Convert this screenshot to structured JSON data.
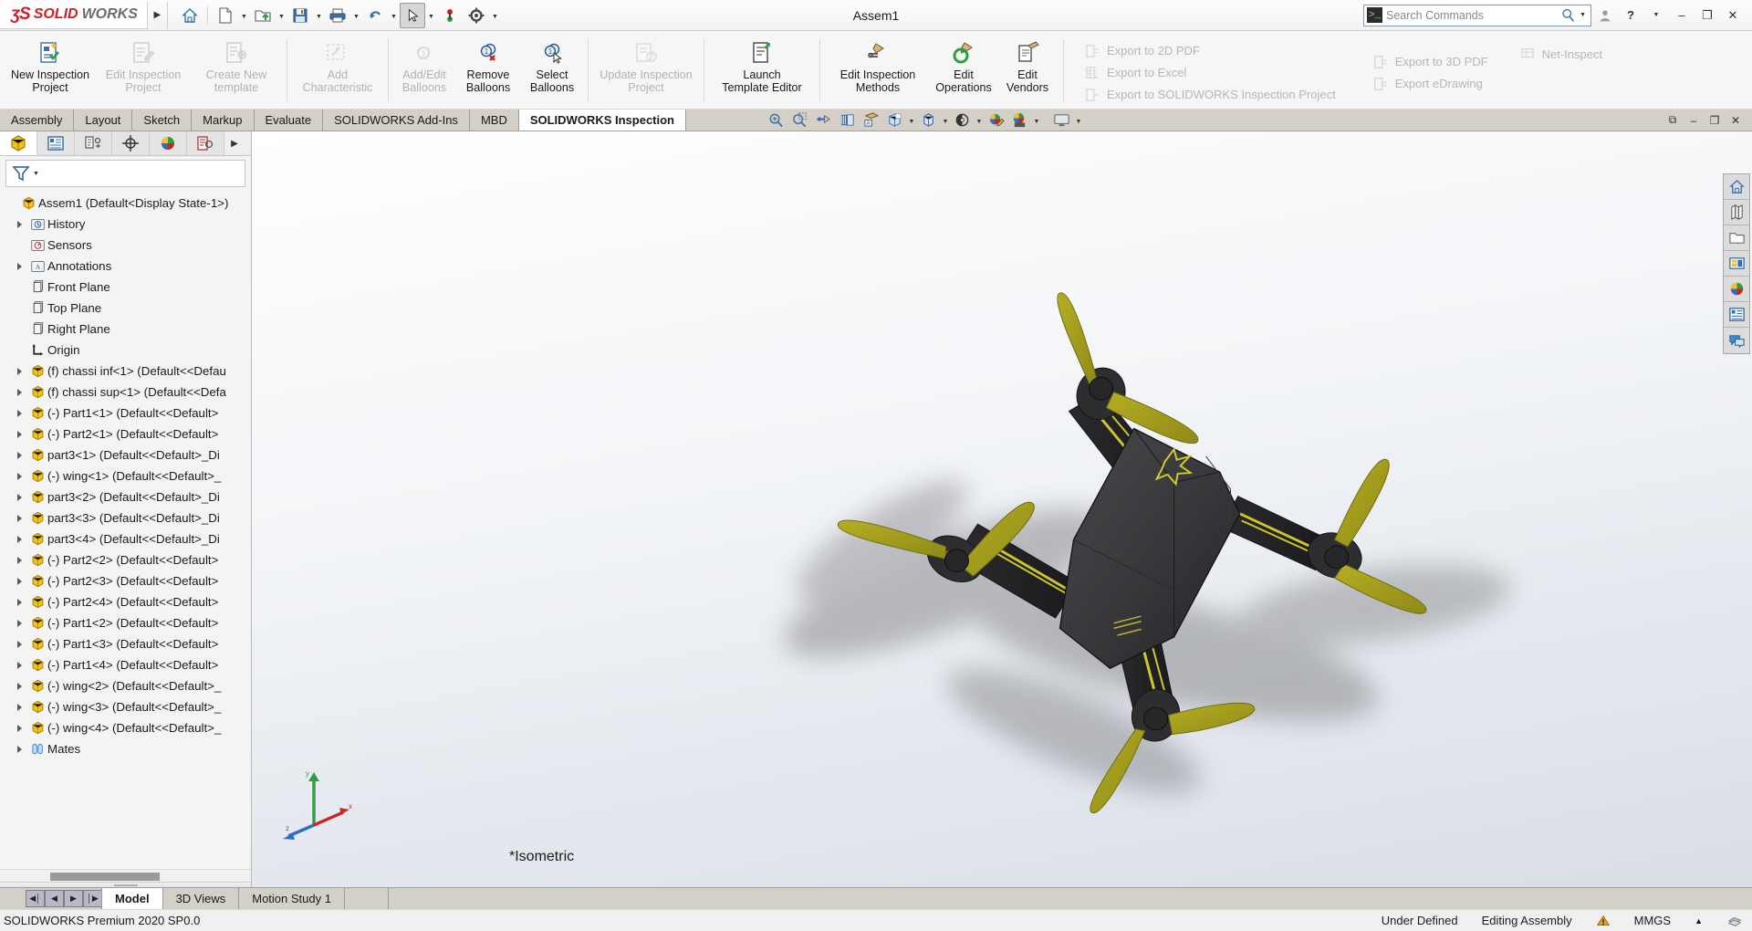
{
  "titlebar": {
    "brand_ds": "ʒS",
    "brand_solid": "SOLID",
    "brand_works": "WORKS",
    "document_title": "Assem1",
    "qat": [
      {
        "name": "home-icon",
        "label": "Home"
      },
      {
        "name": "new-document-icon",
        "label": "New"
      },
      {
        "name": "open-folder-icon",
        "label": "Open"
      },
      {
        "name": "save-icon",
        "label": "Save"
      },
      {
        "name": "print-icon",
        "label": "Print"
      },
      {
        "name": "undo-icon",
        "label": "Undo"
      },
      {
        "name": "select-cursor-icon",
        "label": "Select"
      },
      {
        "name": "rebuild-icon",
        "label": "Rebuild"
      },
      {
        "name": "options-gear-icon",
        "label": "Options"
      }
    ],
    "search_placeholder": "Search Commands",
    "account_label": "Account",
    "help_label": "Help",
    "minimize_label": "–",
    "restore_label": "❐",
    "close_label": "✕"
  },
  "ribbon": {
    "buttons": [
      {
        "label": "New Inspection\nProject",
        "l1": "New Inspection",
        "l2": "Project",
        "icon": "new-inspection-project-icon",
        "disabled": false
      },
      {
        "label": "Edit Inspection Project",
        "l1": "Edit Inspection",
        "l2": "Project",
        "icon": "edit-inspection-project-icon",
        "disabled": true
      },
      {
        "label": "Create New template",
        "l1": "Create New",
        "l2": "template",
        "icon": "create-new-template-icon",
        "disabled": true
      },
      {
        "label": "Add Characteristic",
        "l1": "Add",
        "l2": "Characteristic",
        "icon": "add-characteristic-icon",
        "disabled": true
      },
      {
        "label": "Add/Edit Balloons",
        "l1": "Add/Edit",
        "l2": "Balloons",
        "icon": "add-edit-balloons-icon",
        "disabled": true
      },
      {
        "label": "Remove Balloons",
        "l1": "Remove",
        "l2": "Balloons",
        "icon": "remove-balloons-icon",
        "disabled": false
      },
      {
        "label": "Select Balloons",
        "l1": "Select",
        "l2": "Balloons",
        "icon": "select-balloons-icon",
        "disabled": false
      },
      {
        "label": "Update Inspection Project",
        "l1": "Update Inspection",
        "l2": "Project",
        "icon": "update-inspection-project-icon",
        "disabled": true
      },
      {
        "label": "Launch Template Editor",
        "l1": "Launch",
        "l2": "Template Editor",
        "icon": "launch-template-editor-icon",
        "disabled": false
      },
      {
        "label": "Edit Inspection Methods",
        "l1": "Edit Inspection",
        "l2": "Methods",
        "icon": "edit-inspection-methods-icon",
        "disabled": false
      },
      {
        "label": "Edit Operations",
        "l1": "Edit",
        "l2": "Operations",
        "icon": "edit-operations-icon",
        "disabled": false
      },
      {
        "label": "Edit Vendors",
        "l1": "Edit",
        "l2": "Vendors",
        "icon": "edit-vendors-icon",
        "disabled": false
      }
    ],
    "export_col1": [
      {
        "label": "Export to 2D PDF",
        "icon": "export-2d-pdf-icon",
        "disabled": true
      },
      {
        "label": "Export to Excel",
        "icon": "export-excel-icon",
        "disabled": true
      },
      {
        "label": "Export to SOLIDWORKS Inspection Project",
        "icon": "export-sw-inspection-icon",
        "disabled": true
      }
    ],
    "export_col2": [
      {
        "label": "Export to 3D PDF",
        "icon": "export-3d-pdf-icon",
        "disabled": true
      },
      {
        "label": "Export eDrawing",
        "icon": "export-edrawing-icon",
        "disabled": true
      }
    ],
    "export_col3": [
      {
        "label": "Net-Inspect",
        "icon": "net-inspect-icon",
        "disabled": true
      }
    ]
  },
  "command_tabs": {
    "items": [
      {
        "label": "Assembly",
        "active": false
      },
      {
        "label": "Layout",
        "active": false
      },
      {
        "label": "Sketch",
        "active": false
      },
      {
        "label": "Markup",
        "active": false
      },
      {
        "label": "Evaluate",
        "active": false
      },
      {
        "label": "SOLIDWORKS Add-Ins",
        "active": false
      },
      {
        "label": "MBD",
        "active": false
      },
      {
        "label": "SOLIDWORKS Inspection",
        "active": true
      }
    ]
  },
  "view_toolbar": {
    "items": [
      {
        "name": "zoom-to-fit-icon",
        "label": "Zoom to Fit",
        "caret": false
      },
      {
        "name": "zoom-to-area-icon",
        "label": "Zoom to Area",
        "caret": false
      },
      {
        "name": "previous-view-icon",
        "label": "Previous View",
        "caret": false
      },
      {
        "name": "section-view-icon",
        "label": "Section View",
        "caret": false
      },
      {
        "name": "view-orientation-icon",
        "label": "View Orientation",
        "caret": false
      },
      {
        "name": "display-style-icon",
        "label": "Display Style",
        "caret": true
      },
      {
        "name": "hide-show-items-icon",
        "label": "Hide/Show Items",
        "caret": true
      },
      {
        "name": "edit-appearance-icon",
        "label": "Edit Appearance",
        "caret": false
      },
      {
        "name": "apply-scene-icon",
        "label": "Apply Scene",
        "caret": true
      },
      {
        "name": "view-settings-icon",
        "label": "View Settings",
        "caret": true
      }
    ],
    "window_buttons": [
      {
        "name": "restore-panel-icon",
        "label": "⧉"
      },
      {
        "name": "minimize-window-icon",
        "label": "–"
      },
      {
        "name": "restore-window-icon",
        "label": "❐"
      },
      {
        "name": "close-window-icon",
        "label": "✕"
      }
    ]
  },
  "feature_manager": {
    "tabs": [
      {
        "name": "featuremanager-design-tree-tab",
        "label": "FeatureManager design tree",
        "active": true
      },
      {
        "name": "property-manager-tab",
        "label": "PropertyManager",
        "active": false
      },
      {
        "name": "configuration-manager-tab",
        "label": "ConfigurationManager",
        "active": false
      },
      {
        "name": "dimxpert-manager-tab",
        "label": "DimXpertManager",
        "active": false
      },
      {
        "name": "display-manager-tab",
        "label": "DisplayManager",
        "active": false
      },
      {
        "name": "inspection-manager-tab",
        "label": "Inspection Manager",
        "active": false
      }
    ],
    "filter_placeholder": "",
    "root": "Assem1  (Default<Display State-1>)",
    "tree": [
      {
        "label": "History",
        "icon": "history-icon",
        "expandable": true,
        "indent": 1
      },
      {
        "label": "Sensors",
        "icon": "sensors-icon",
        "expandable": false,
        "indent": 1
      },
      {
        "label": "Annotations",
        "icon": "annotations-icon",
        "expandable": true,
        "indent": 1
      },
      {
        "label": "Front Plane",
        "icon": "plane-icon",
        "expandable": false,
        "indent": 1
      },
      {
        "label": "Top Plane",
        "icon": "plane-icon",
        "expandable": false,
        "indent": 1
      },
      {
        "label": "Right Plane",
        "icon": "plane-icon",
        "expandable": false,
        "indent": 1
      },
      {
        "label": "Origin",
        "icon": "origin-icon",
        "expandable": false,
        "indent": 1
      },
      {
        "label": "(f) chassi inf<1>  (Default<<Defau",
        "icon": "part-icon",
        "expandable": true,
        "indent": 1
      },
      {
        "label": "(f) chassi sup<1>  (Default<<Defa",
        "icon": "part-icon",
        "expandable": true,
        "indent": 1
      },
      {
        "label": "(-) Part1<1>  (Default<<Default>",
        "icon": "part-icon",
        "expandable": true,
        "indent": 1
      },
      {
        "label": "(-) Part2<1>  (Default<<Default>",
        "icon": "part-icon",
        "expandable": true,
        "indent": 1
      },
      {
        "label": "part3<1>  (Default<<Default>_Di",
        "icon": "part-icon",
        "expandable": true,
        "indent": 1
      },
      {
        "label": "(-) wing<1>  (Default<<Default>_",
        "icon": "part-icon",
        "expandable": true,
        "indent": 1
      },
      {
        "label": "part3<2>  (Default<<Default>_Di",
        "icon": "part-icon",
        "expandable": true,
        "indent": 1
      },
      {
        "label": "part3<3>  (Default<<Default>_Di",
        "icon": "part-icon",
        "expandable": true,
        "indent": 1
      },
      {
        "label": "part3<4>  (Default<<Default>_Di",
        "icon": "part-icon",
        "expandable": true,
        "indent": 1
      },
      {
        "label": "(-) Part2<2>  (Default<<Default>",
        "icon": "part-icon",
        "expandable": true,
        "indent": 1
      },
      {
        "label": "(-) Part2<3>  (Default<<Default>",
        "icon": "part-icon",
        "expandable": true,
        "indent": 1
      },
      {
        "label": "(-) Part2<4>  (Default<<Default>",
        "icon": "part-icon",
        "expandable": true,
        "indent": 1
      },
      {
        "label": "(-) Part1<2>  (Default<<Default>",
        "icon": "part-icon",
        "expandable": true,
        "indent": 1
      },
      {
        "label": "(-) Part1<3>  (Default<<Default>",
        "icon": "part-icon",
        "expandable": true,
        "indent": 1
      },
      {
        "label": "(-) Part1<4>  (Default<<Default>",
        "icon": "part-icon",
        "expandable": true,
        "indent": 1
      },
      {
        "label": "(-) wing<2>  (Default<<Default>_",
        "icon": "part-icon",
        "expandable": true,
        "indent": 1
      },
      {
        "label": "(-) wing<3>  (Default<<Default>_",
        "icon": "part-icon",
        "expandable": true,
        "indent": 1
      },
      {
        "label": "(-) wing<4>  (Default<<Default>_",
        "icon": "part-icon",
        "expandable": true,
        "indent": 1
      },
      {
        "label": "Mates",
        "icon": "mates-icon",
        "expandable": true,
        "indent": 1
      }
    ]
  },
  "viewport": {
    "view_name": "*Isometric",
    "axis_labels": {
      "x": "x",
      "y": "y",
      "z": "z"
    },
    "model_colors": {
      "body_dark": "#3a3a3c",
      "body_shadow": "#1e1e20",
      "propeller": "#a8a11e",
      "highlight": "#d8d430",
      "background_top": "#ffffff",
      "background_bottom": "#d8dde6"
    },
    "right_toolbar": [
      {
        "name": "view-home-icon",
        "label": "Home"
      },
      {
        "name": "view-display-pane-icon",
        "label": "Display Pane"
      },
      {
        "name": "view-folder-icon",
        "label": "Open Folder"
      },
      {
        "name": "view-appearances-panel-icon",
        "label": "Appearances"
      },
      {
        "name": "view-color-sphere-icon",
        "label": "Scenes"
      },
      {
        "name": "view-custom-properties-icon",
        "label": "Custom Properties"
      },
      {
        "name": "view-comments-icon",
        "label": "Comments"
      }
    ]
  },
  "bottom_tabs": {
    "nav": [
      {
        "name": "first-tab-button",
        "label": "◀│"
      },
      {
        "name": "previous-tab-button",
        "label": "◀"
      },
      {
        "name": "next-tab-button",
        "label": "▶"
      },
      {
        "name": "last-tab-button",
        "label": "│▶"
      }
    ],
    "tabs": [
      {
        "label": "Model",
        "active": true
      },
      {
        "label": "3D Views",
        "active": false
      },
      {
        "label": "Motion Study 1",
        "active": false
      }
    ]
  },
  "statusbar": {
    "version": "SOLIDWORKS Premium 2020 SP0.0",
    "state": "Under Defined",
    "mode": "Editing Assembly",
    "units": "MMGS",
    "units_caret": "▲"
  }
}
